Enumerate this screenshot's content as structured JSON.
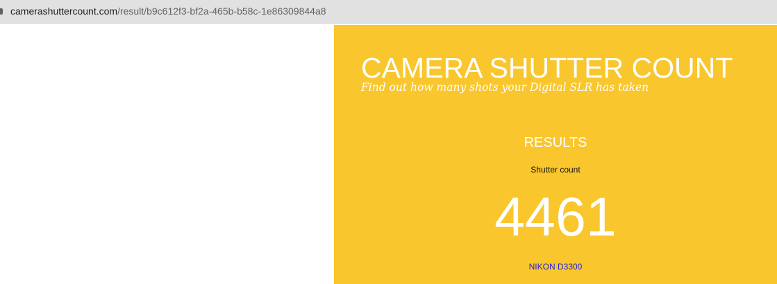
{
  "browser": {
    "url_host": "camerashuttercount.com",
    "url_path": "/result/b9c612f3-bf2a-465b-b58c-1e86309844a8"
  },
  "colors": {
    "accent_background": "#f9c62d",
    "heading_text": "#ffffff",
    "link": "#2424d6"
  },
  "header": {
    "title": "CAMERA SHUTTER COUNT",
    "tagline": "Find out how many shots your Digital SLR has taken"
  },
  "results": {
    "heading": "RESULTS",
    "count_label": "Shutter count",
    "count_value": "4461",
    "camera_model": "NIKON D3300"
  }
}
